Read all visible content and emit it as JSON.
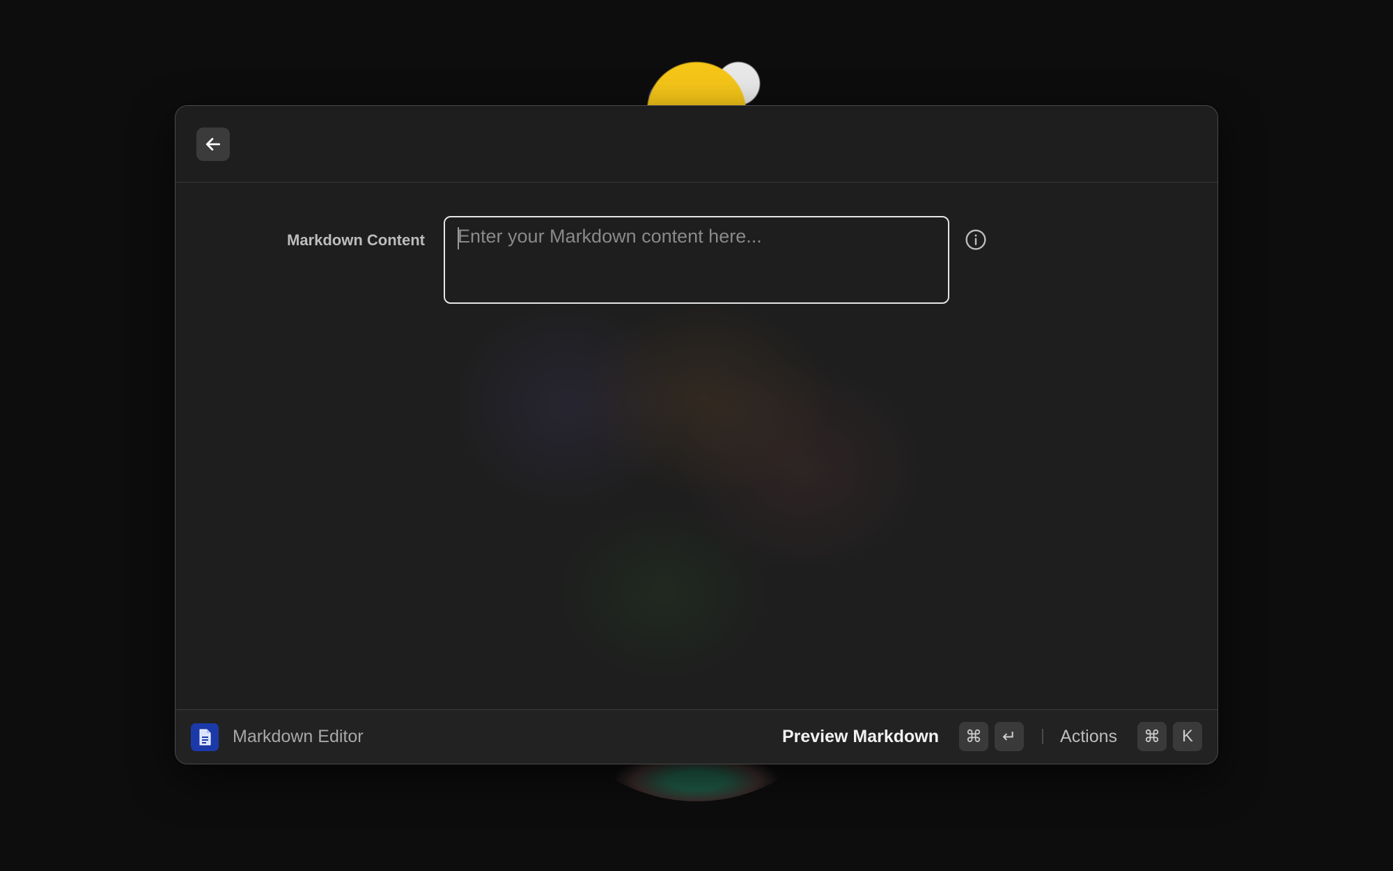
{
  "form": {
    "label": "Markdown Content",
    "placeholder": "Enter your Markdown content here...",
    "value": ""
  },
  "footer": {
    "app_name": "Markdown Editor",
    "primary_action": "Preview Markdown",
    "primary_shortcut": [
      "⌘",
      "↵"
    ],
    "actions_label": "Actions",
    "actions_shortcut": [
      "⌘",
      "K"
    ]
  },
  "icons": {
    "back": "arrow-left-icon",
    "info": "info-icon",
    "app": "markdown-document-icon"
  },
  "colors": {
    "window_bg": "#1e1e1e",
    "input_border": "#e6e6e6",
    "app_icon_bg": "#1b39a8",
    "placeholder_text": "#8a8a8a"
  }
}
